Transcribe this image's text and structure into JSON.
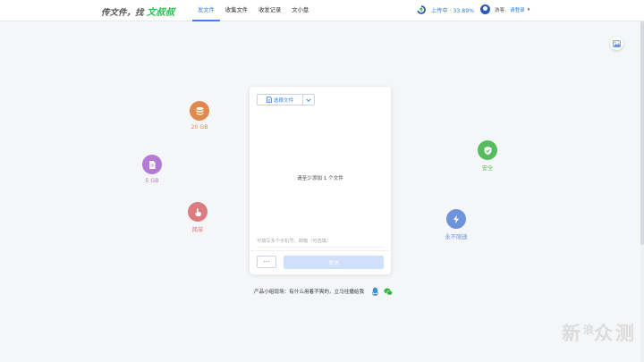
{
  "header": {
    "logo_prefix": "传文件，找 ",
    "logo_brand": "文叔叔",
    "nav": [
      {
        "label": "发文件",
        "active": true
      },
      {
        "label": "收集文件",
        "active": false
      },
      {
        "label": "收发记录",
        "active": false
      },
      {
        "label": "文小盘",
        "active": false
      }
    ],
    "upload_status": "上传中 · 33.89%",
    "guest_label": "游客,",
    "login_label": "请登录"
  },
  "features": {
    "storage_20gb": {
      "label": "20 GB",
      "color": "#e0894e",
      "icon": "database-icon"
    },
    "file_5gb": {
      "label": "5 GB",
      "color": "#b57ad6",
      "icon": "document-icon"
    },
    "simple": {
      "label": "简单",
      "color": "#dc7b80",
      "icon": "hand-pointer-icon"
    },
    "secure": {
      "label": "安全",
      "color": "#56bd5f",
      "icon": "shield-icon"
    },
    "never_slow": {
      "label": "永不限速",
      "color": "#6e92dc",
      "icon": "lightning-icon"
    }
  },
  "card": {
    "select_file_label": "选择文件",
    "drop_hint": "请至少添加 1 个文件",
    "recipient_placeholder": "可填写多个手机号、邮箱（可选填）",
    "more_label": "···",
    "send_label": "发送"
  },
  "footer": {
    "feedback": "产品小组现场：有什么用着不爽的，立马往播给我"
  },
  "watermark": {
    "main": "新",
    "small": "浪",
    "tail": "众测"
  },
  "colors": {
    "accent": "#2b7de9",
    "brand_green": "#2bbd53"
  }
}
